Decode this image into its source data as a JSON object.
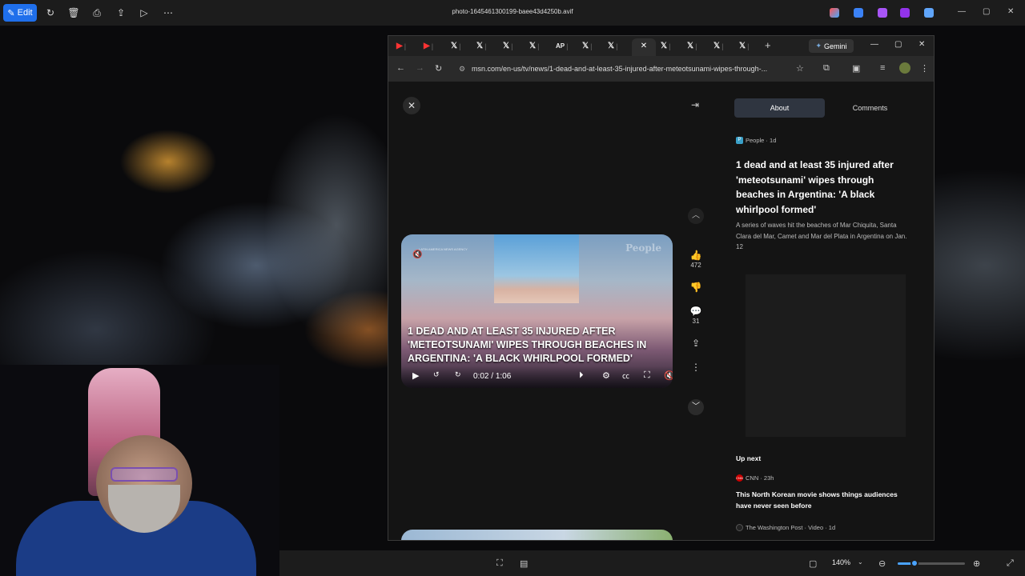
{
  "viewer": {
    "edit_label": "Edit",
    "file_title": "photo-1645461300199-baee43d4250b.avif",
    "zoom_level": "140%",
    "zoom_fraction": 0.25
  },
  "browser": {
    "gemini_label": "Gemini",
    "url": "msn.com/en-us/tv/news/1-dead-and-at-least-35-injured-after-meteotsunami-wipes-through-...",
    "tabs": [
      "YouTube",
      "YouTube",
      "X",
      "X",
      "X",
      "X",
      "AP",
      "X",
      "X",
      "msn",
      "X",
      "X",
      "X"
    ]
  },
  "page": {
    "tabs": {
      "about": "About",
      "comments": "Comments"
    },
    "source": "People · 1d",
    "headline": "1 dead and at least 35 injured after 'meteotsunami' wipes through beaches in Argentina: 'A black whirlpool formed'",
    "summary": "A series of waves hit the beaches of Mar Chiquita, Santa Clara del Mar, Camet and Mar del Plata in Argentina on Jan. 12",
    "likes": "472",
    "comments_count": "31",
    "up_next_label": "Up next",
    "up_next": [
      {
        "source": "CNN · 23h",
        "title": "This North Korean movie shows things audiences have never seen before"
      },
      {
        "source": "The Washington Post · Video · 1d",
        "title": ""
      }
    ]
  },
  "video": {
    "brand": "LATIN AMERICA NEWS AGENCY",
    "watermark": "People",
    "caption": "1 DEAD AND AT LEAST 35 INJURED AFTER 'METEOTSUNAMI' WIPES THROUGH BEACHES IN ARGENTINA: 'A BLACK WHIRLPOOL FORMED'",
    "current_time": "0:02",
    "separator": "/",
    "duration": "1:06"
  }
}
